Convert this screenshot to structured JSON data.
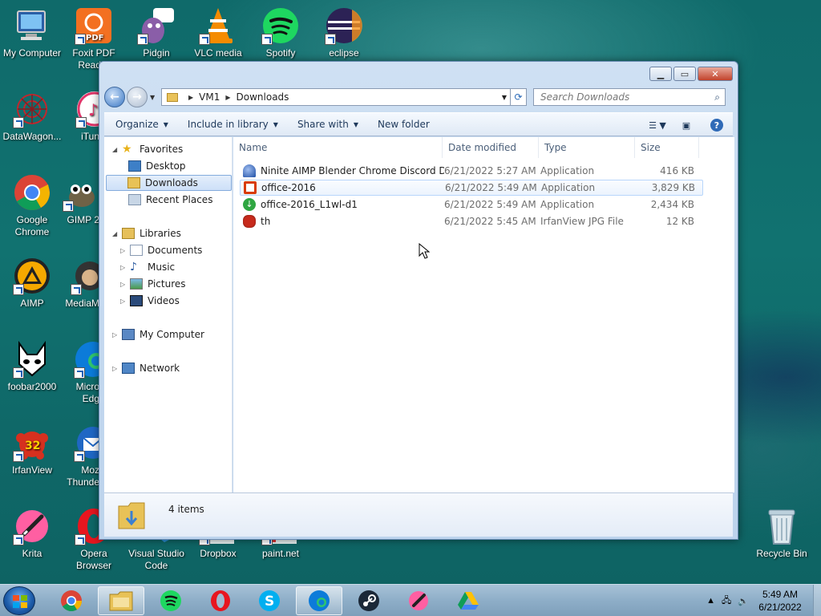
{
  "desktop_icons": [
    {
      "label": "My Computer",
      "icon": "computer-icon"
    },
    {
      "label": "Foxit PDF Reader",
      "icon": "foxit-pdf-icon"
    },
    {
      "label": "Pidgin",
      "icon": "pidgin-icon"
    },
    {
      "label": "VLC media",
      "icon": "vlc-icon"
    },
    {
      "label": "Spotify",
      "icon": "spotify-icon"
    },
    {
      "label": "eclipse",
      "icon": "eclipse-icon"
    },
    {
      "label": "DataWagon...",
      "icon": "datawagon-icon"
    },
    {
      "label": "iTun",
      "icon": "itunes-icon"
    },
    {
      "label": "Google Chrome",
      "icon": "chrome-icon"
    },
    {
      "label": "GIMP 2",
      "icon": "gimp-icon"
    },
    {
      "label": "AIMP",
      "icon": "aimp-icon"
    },
    {
      "label": "MediaM",
      "icon": "mediamonkey-icon"
    },
    {
      "label": "foobar2000",
      "icon": "foobar-icon"
    },
    {
      "label": "Micro Edg",
      "icon": "edge-icon"
    },
    {
      "label": "IrfanView",
      "icon": "irfanview-icon"
    },
    {
      "label": "Moz Thunde",
      "icon": "thunderbird-icon"
    },
    {
      "label": "Krita",
      "icon": "krita-icon"
    },
    {
      "label": "Opera Browser",
      "icon": "opera-icon"
    },
    {
      "label": "Visual Studio Code",
      "icon": "vscode-icon"
    },
    {
      "label": "Dropbox",
      "icon": "dropbox-icon"
    },
    {
      "label": "paint.net",
      "icon": "paintnet-icon"
    },
    {
      "label": "Recycle Bin",
      "icon": "recycle-bin-icon"
    }
  ],
  "explorer": {
    "path": [
      "VM1",
      "Downloads"
    ],
    "search_placeholder": "Search Downloads",
    "toolbar": {
      "organize": "Organize",
      "include_in_library": "Include in library",
      "share_with": "Share with",
      "new_folder": "New folder"
    },
    "nav": {
      "favorites": "Favorites",
      "desktop": "Desktop",
      "downloads": "Downloads",
      "recent_places": "Recent Places",
      "libraries": "Libraries",
      "documents": "Documents",
      "music": "Music",
      "pictures": "Pictures",
      "videos": "Videos",
      "my_computer": "My Computer",
      "network": "Network"
    },
    "columns": {
      "name": "Name",
      "date_modified": "Date modified",
      "type": "Type",
      "size": "Size"
    },
    "files": [
      {
        "name": "Ninite AIMP Blender Chrome Discord Dr...",
        "date": "6/21/2022 5:27 AM",
        "type": "Application",
        "size": "416 KB",
        "icon": "ninite-icon"
      },
      {
        "name": "office-2016",
        "date": "6/21/2022 5:49 AM",
        "type": "Application",
        "size": "3,829 KB",
        "icon": "office-icon"
      },
      {
        "name": "office-2016_L1wl-d1",
        "date": "6/21/2022 5:49 AM",
        "type": "Application",
        "size": "2,434 KB",
        "icon": "green-download-icon"
      },
      {
        "name": "th",
        "date": "6/21/2022 5:45 AM",
        "type": "IrfanView JPG File",
        "size": "12 KB",
        "icon": "irfanview-file-icon"
      }
    ],
    "item_count": "4 items"
  },
  "taskbar": {
    "time": "5:49 AM",
    "date": "6/21/2022",
    "pinned": [
      "chrome-icon",
      "explorer-icon",
      "spotify-icon",
      "opera-icon",
      "skype-icon",
      "edge-icon",
      "steam-icon",
      "krita-icon",
      "google-drive-icon"
    ]
  }
}
